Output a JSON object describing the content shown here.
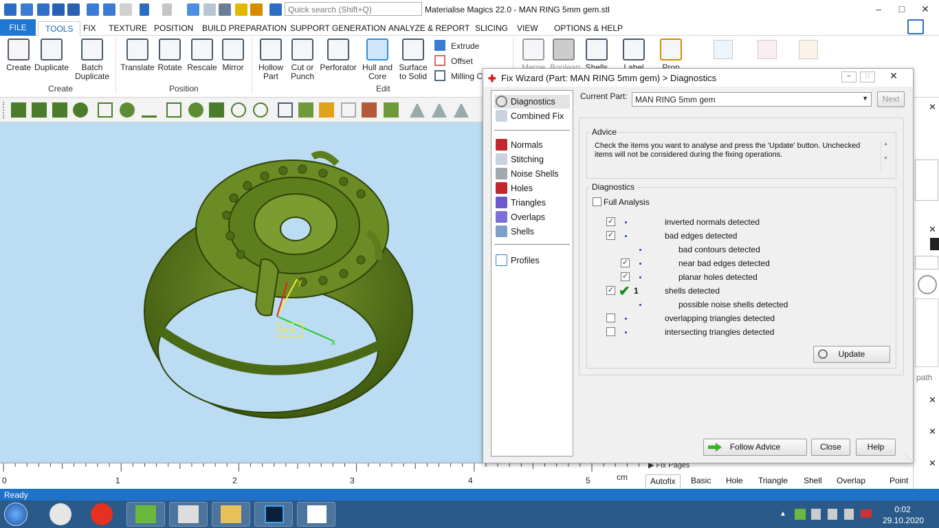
{
  "app": {
    "title": "Materialise Magics 22.0 - MAN RING 5mm gem.stl",
    "search_placeholder": "Quick search (Shift+Q)"
  },
  "tabs": [
    "FILE",
    "TOOLS",
    "FIX",
    "TEXTURE",
    "POSITION",
    "BUILD PREPARATION",
    "SUPPORT GENERATION",
    "ANALYZE & REPORT",
    "SLICING",
    "VIEW",
    "OPTIONS & HELP"
  ],
  "ribbon": {
    "create": {
      "label": "Create",
      "buttons": [
        {
          "l1": "Create",
          "l2": ""
        },
        {
          "l1": "Duplicate",
          "l2": ""
        },
        {
          "l1": "Batch",
          "l2": "Duplicate"
        }
      ]
    },
    "position": {
      "label": "Position",
      "buttons": [
        {
          "l1": "Translate",
          "l2": ""
        },
        {
          "l1": "Rotate",
          "l2": ""
        },
        {
          "l1": "Rescale",
          "l2": ""
        },
        {
          "l1": "Mirror",
          "l2": ""
        }
      ]
    },
    "edit": {
      "label": "Edit",
      "buttons": [
        {
          "l1": "Hollow",
          "l2": "Part"
        },
        {
          "l1": "Cut or",
          "l2": "Punch"
        },
        {
          "l1": "Perforator",
          "l2": ""
        },
        {
          "l1": "Hull and",
          "l2": "Core"
        },
        {
          "l1": "Surface",
          "l2": "to Solid"
        }
      ],
      "small": [
        "Extrude",
        "Offset",
        "Milling C"
      ]
    },
    "partial": [
      "Merge",
      "Boolean",
      "Shells",
      "Label",
      "Prop"
    ]
  },
  "viewport": {
    "axis_x": "x",
    "axis_y": "y",
    "wcs": "WCS"
  },
  "ruler": {
    "labels": [
      "0",
      "1",
      "2",
      "3",
      "4",
      "5"
    ],
    "unit": "cm"
  },
  "status": "Ready",
  "fix_pages": {
    "title": "Fix Pages",
    "tabs": [
      "Autofix",
      "Basic",
      "Hole",
      "Triangle",
      "Shell",
      "Overlap",
      "Point"
    ]
  },
  "right_panel": {
    "path_text": "path"
  },
  "dialog": {
    "title": "Fix Wizard (Part: MAN RING 5mm gem) > Diagnostics",
    "nav_top": [
      "Diagnostics",
      "Combined Fix"
    ],
    "nav_items": [
      "Normals",
      "Stitching",
      "Noise Shells",
      "Holes",
      "Triangles",
      "Overlaps",
      "Shells"
    ],
    "nav_bottom": [
      "Profiles"
    ],
    "current_part_label": "Current Part:",
    "current_part_value": "MAN RING 5mm gem",
    "next_label": "Next",
    "advice_title": "Advice",
    "advice_text": "Check the items you want to analyse and press the 'Update' button. Unchecked items will not be considered during the fixing operations.",
    "diagnostics_title": "Diagnostics",
    "full_analysis": "Full Analysis",
    "items": [
      {
        "text": "inverted normals detected",
        "checked": true,
        "indent": 0,
        "result": ""
      },
      {
        "text": "bad edges detected",
        "checked": true,
        "indent": 0,
        "result": ""
      },
      {
        "text": "bad contours detected",
        "checked": null,
        "indent": 1,
        "result": ""
      },
      {
        "text": "near bad edges detected",
        "checked": true,
        "indent": 1,
        "result": ""
      },
      {
        "text": "planar holes detected",
        "checked": true,
        "indent": 1,
        "result": ""
      },
      {
        "text": "shells detected",
        "checked": true,
        "indent": 0,
        "result": "1"
      },
      {
        "text": "possible noise shells detected",
        "checked": null,
        "indent": 1,
        "result": ""
      },
      {
        "text": "overlapping triangles detected",
        "checked": false,
        "indent": 0,
        "result": ""
      },
      {
        "text": "intersecting triangles detected",
        "checked": false,
        "indent": 0,
        "result": ""
      }
    ],
    "update_label": "Update",
    "follow_advice_label": "Follow Advice",
    "close_label": "Close",
    "help_label": "Help"
  },
  "taskbar": {
    "time": "0:02",
    "date": "29.10.2020"
  },
  "colors": {
    "ribbon_blue": "#1e77d3",
    "viewport_bg": "#bcdcf3",
    "ring_green": "#5a7a1c",
    "status_blue": "#1e72c8"
  }
}
